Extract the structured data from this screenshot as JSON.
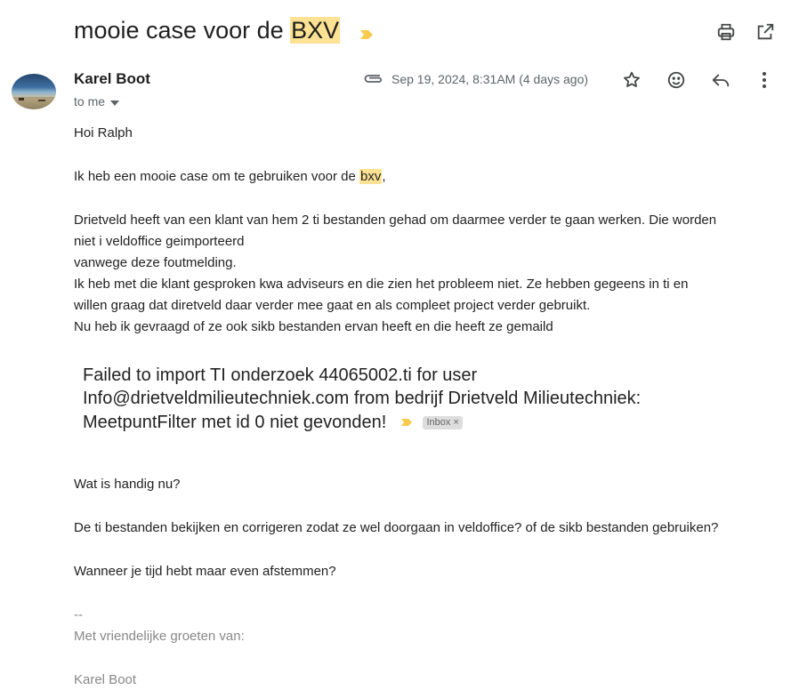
{
  "subject": {
    "text": "mooie case voor de ",
    "highlight": "BXV"
  },
  "toolbar": {
    "print_icon": "print-icon",
    "open_new_window_icon": "open-in-new-icon"
  },
  "message": {
    "sender": "Karel Boot",
    "recipient_label": "to me",
    "date": "Sep 19, 2024, 8:31AM (4 days ago)",
    "actions": [
      "star-icon",
      "emoji-icon",
      "reply-icon",
      "more-vert-icon"
    ]
  },
  "body": {
    "greeting": "Hoi Ralph",
    "intro_pre": "Ik heb een mooie case om te gebruiken voor de ",
    "intro_highlight": "bxv",
    "intro_post": ",",
    "para1_line1": "Drietveld heeft van een klant van hem 2 ti bestanden gehad om daarmee verder te gaan werken. Die worden",
    "para1_line2": "niet i veldoffice geimporteerd",
    "para1_line3": "vanwege deze foutmelding.",
    "para1_line4": "Ik heb met die klant gesproken kwa adviseurs en die zien het probleem niet. Ze hebben gegeens in ti en",
    "para1_line5": "willen graag dat diretveld daar verder mee gaat en als compleet project verder gebruikt.",
    "para1_line6": "Nu heb ik gevraagd of ze ook sikb bestanden ervan heeft en die heeft ze gemaild",
    "quote_line1": "Failed to import TI onderzoek 44065002.ti for user",
    "quote_line2": "Info@drietveldmilieutechniek.com from bedrijf Drietveld Milieutechniek:",
    "quote_line3": "MeetpuntFilter met id 0 niet gevonden!",
    "inbox_label": "Inbox",
    "inbox_remove": "×",
    "question": "Wat is handig nu?",
    "option": "De ti bestanden bekijken en corrigeren zodat ze wel doorgaan in veldoffice? of de sikb bestanden gebruiken?",
    "closing": "Wanneer je tijd hebt maar even afstemmen?",
    "sig_dash": "--",
    "sig_greeting": "Met vriendelijke groeten van:",
    "sig_name": "Karel Boot"
  },
  "colors": {
    "highlight": "#fde293",
    "importance": "#f7cb4d",
    "muted": "#5f6368"
  }
}
